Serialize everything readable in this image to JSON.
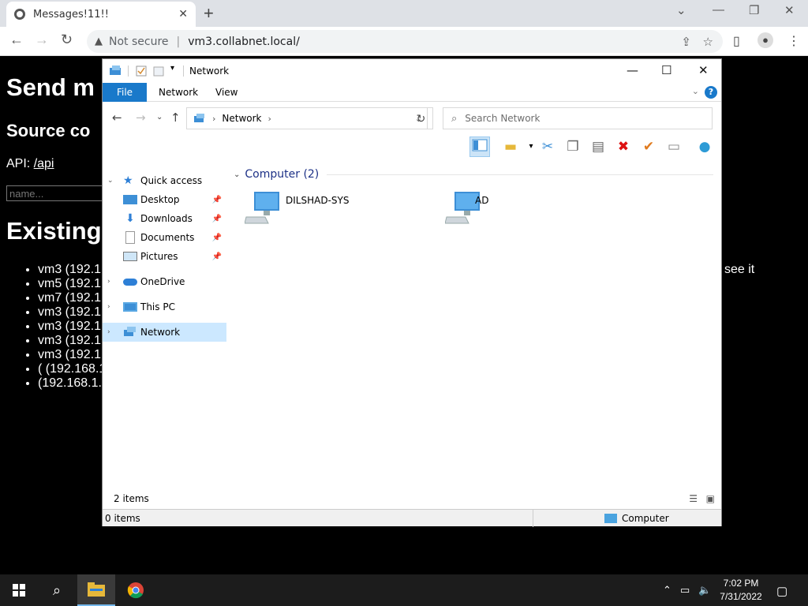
{
  "browser": {
    "tab_title": "Messages!11!!",
    "security_label": "Not secure",
    "url": "vm3.collabnet.local/"
  },
  "page": {
    "heading_send": "Send m",
    "heading_source": "Source co",
    "api_label": "API:",
    "api_link": "/api",
    "name_placeholder": "name...",
    "heading_existing": "Existing",
    "list_items": [
      "vm3 (192.1",
      "vm5 (192.1",
      "vm7 (192.1",
      "vm3 (192.1",
      "vm3 (192.1",
      "vm3 (192.1",
      "vm3 (192.1",
      "( (192.168.1",
      "(192.168.1."
    ],
    "right_text": "see it"
  },
  "explorer": {
    "title": "Network",
    "ribbon_tabs": [
      "File",
      "Network",
      "View"
    ],
    "breadcrumb": "Network",
    "search_placeholder": "Search Network",
    "nav": {
      "quick_access": "Quick access",
      "desktop": "Desktop",
      "downloads": "Downloads",
      "documents": "Documents",
      "pictures": "Pictures",
      "onedrive": "OneDrive",
      "this_pc": "This PC",
      "network": "Network"
    },
    "group_header": "Computer (2)",
    "computers": [
      "DILSHAD-SYS",
      "AD"
    ],
    "status_items": "2 items",
    "status_selected": "0 items",
    "status_zone": "Computer"
  },
  "taskbar": {
    "time": "7:02 PM",
    "date": "7/31/2022"
  }
}
